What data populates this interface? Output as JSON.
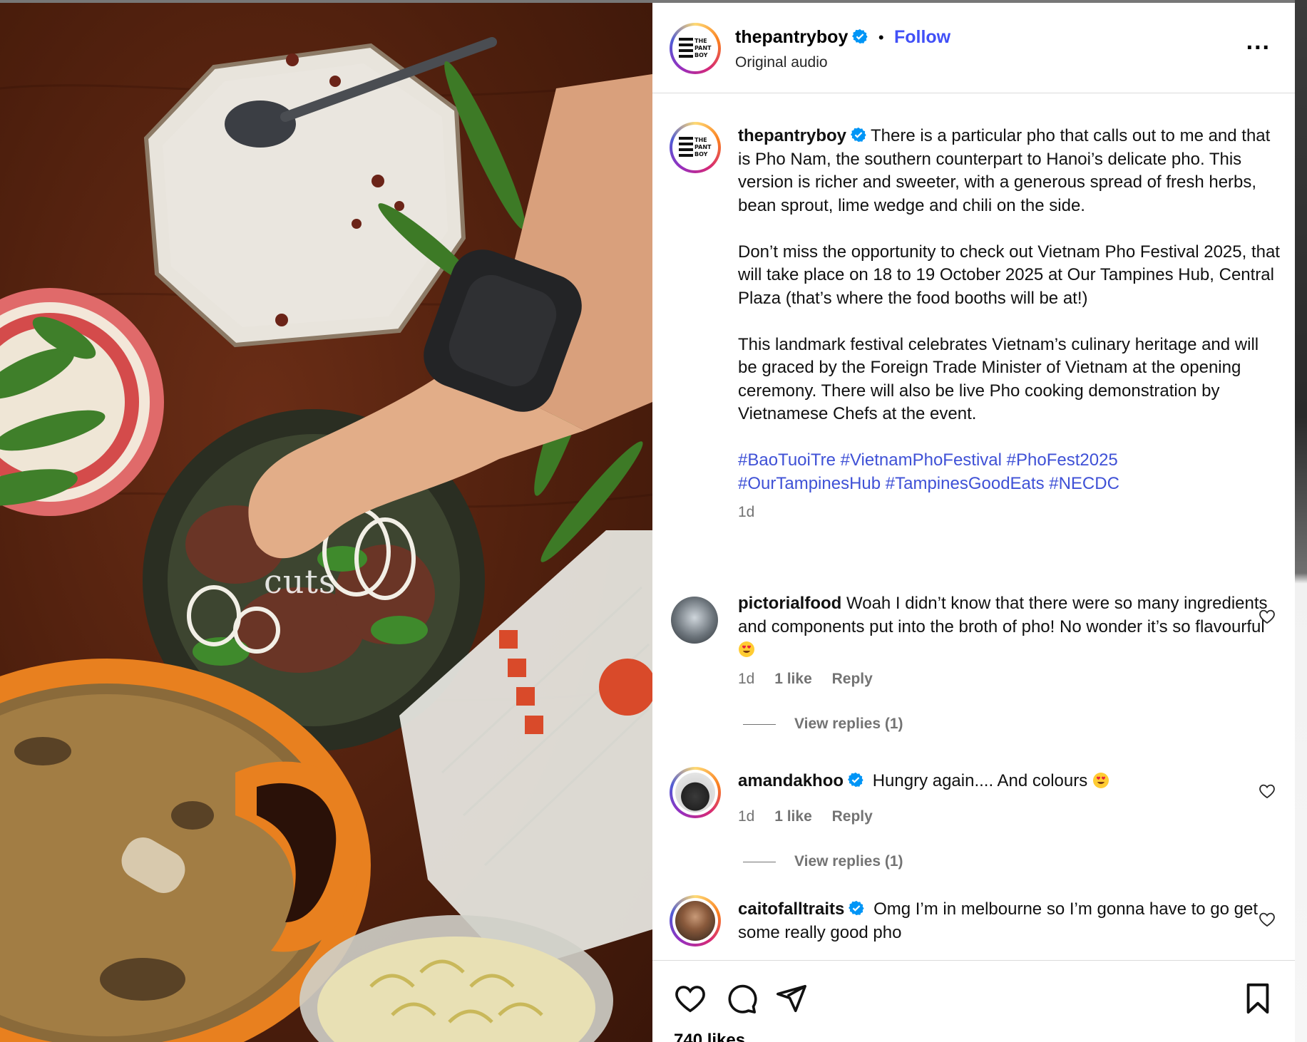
{
  "post": {
    "username": "thepantryboy",
    "follow_label": "Follow",
    "separator": "•",
    "audio": "Original audio",
    "more_label": "..."
  },
  "media": {
    "overlay_text": "cuts"
  },
  "caption": {
    "username": "thepantryboy",
    "paragraphs": [
      "There is a particular pho that calls out to me and that is Pho Nam, the southern counterpart to Hanoi’s delicate pho. This version is richer and sweeter, with a generous spread of fresh herbs, bean sprout, lime wedge and chili on the side.",
      "Don’t miss the opportunity to check out Vietnam Pho Festival 2025, that will take place on 18 to 19 October 2025 at Our Tampines Hub, Central Plaza (that’s where the food booths will be at!)",
      "This landmark festival celebrates Vietnam’s culinary heritage and will be graced by the Foreign Trade Minister of Vietnam at the opening ceremony. There will also be live Pho cooking demonstration by Vietnamese Chefs at the event."
    ],
    "hashtags_line1": "#BaoTuoiTre #VietnamPhoFestival #PhoFest2025",
    "hashtags_line2": "#OurTampinesHub #TampinesGoodEats #NECDC",
    "time": "1d"
  },
  "comments": [
    {
      "username": "pictorialfood",
      "text": "Woah I didn’t know that there were so many ingredients and components put into the broth of pho! No wonder it’s so flavourful",
      "time": "1d",
      "likes": "1 like",
      "reply": "Reply",
      "view_replies": "View replies (1)"
    },
    {
      "username": "amandakhoo",
      "text": "Hungry again.... And colours",
      "time": "1d",
      "likes": "1 like",
      "reply": "Reply",
      "view_replies": "View replies (1)"
    },
    {
      "username": "caitofalltraits",
      "text": "Omg I’m in melbourne so I’m gonna have to go get some really good pho"
    }
  ],
  "likes_count": "740 likes",
  "colors": {
    "link": "#4150f7",
    "hashtag": "#3f51d6",
    "verified": "#0095f6",
    "muted": "#737373"
  }
}
